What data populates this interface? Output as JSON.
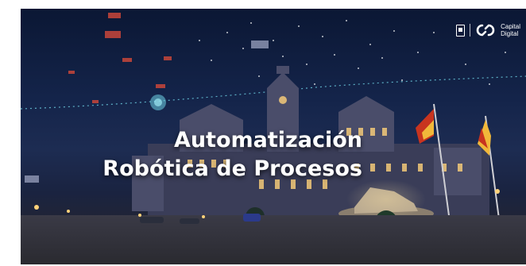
{
  "banner": {
    "title_line1": "Automatización",
    "title_line2": "Robótica de Procesos"
  },
  "brand": {
    "name_line1": "Capital",
    "name_line2": "Digital",
    "logo_icon": "linked-loop-icon",
    "crest_icon": "madrid-crest-icon"
  },
  "colors": {
    "sky_top": "#0b1734",
    "building": "#3a3d58",
    "lights": "#ffd27a",
    "accent_cyan": "#6fd3e6",
    "flag_red": "#c8341f",
    "flag_yellow": "#f1b83a"
  }
}
